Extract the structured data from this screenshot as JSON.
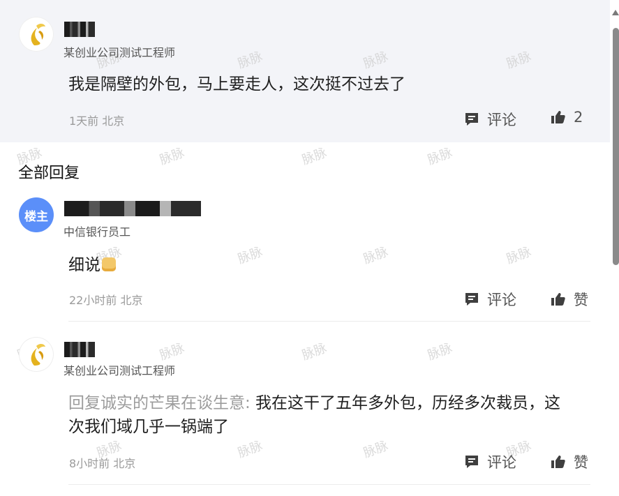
{
  "comments": {
    "main": {
      "title": "某创业公司测试工程师",
      "content": "我是隔壁的外包，马上要走人，这次挺不过去了",
      "meta": "1天前 北京",
      "comment_label": "评论",
      "like_count": "2"
    },
    "section_header": "全部回复",
    "reply1": {
      "badge": "楼主",
      "title": "中信银行员工",
      "content": "细说",
      "meta": "22小时前 北京",
      "comment_label": "评论",
      "like_label": "赞"
    },
    "reply2": {
      "title": "某创业公司测试工程师",
      "reply_prefix": "回复诚实的芒果在谈生意:",
      "content_line1": " 我在这干了五年多外包，历经多次裁员，这",
      "content_line2": "次我们域几乎一锅端了",
      "meta": "8小时前 北京",
      "comment_label": "评论",
      "like_label": "赞"
    }
  },
  "watermark_text": "脉脉",
  "icons": {
    "comment": "comment-icon",
    "like": "thumbs-up-icon"
  },
  "colors": {
    "top_bg": "#f3f4f8",
    "host_badge": "#5b8ff9",
    "meta_text": "#9a9a9a"
  }
}
